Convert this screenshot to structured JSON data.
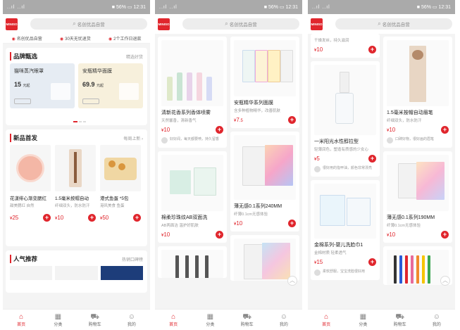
{
  "status": {
    "carrier": "..ıl ..ıl",
    "right": "■ 56% ▭ 12:31"
  },
  "logo": "MINISO",
  "search": {
    "placeholder": "名创优品自营"
  },
  "promises": [
    "名创优品自营",
    "30天无忧退货",
    "2个工作日退款"
  ],
  "screen1": {
    "brand": {
      "title": "品牌甄选",
      "more": "精选好货",
      "cards": [
        {
          "title": "猫咪蒸汽眼罩",
          "price": "15",
          "unit": "元起"
        },
        {
          "title": "安瓶精华面膜",
          "price": "69.9",
          "unit": "元起"
        }
      ]
    },
    "new": {
      "title": "新品首发",
      "more": "每周上新 ›",
      "items": [
        {
          "name": "花漾绯心渐变腮红",
          "sub": "甜美腮红 自然",
          "price": "25"
        },
        {
          "name": "1.5毫米按帽自动",
          "sub": "纤细双头，防水防汗",
          "price": "10"
        },
        {
          "name": "港式鱼蛋 *5包",
          "sub": "港风美食 鱼蛋",
          "price": "50"
        }
      ]
    },
    "popular": {
      "title": "人气推荐",
      "more": "热销口碑榜"
    }
  },
  "screen2": {
    "left": [
      {
        "name": "清新花香系列香体喷雾",
        "sub": "天然馨香，清新香气",
        "price": "10",
        "review": "好好闻，每天都要喷，持久留香"
      },
      {
        "name": "棉柔珍珠纹AB双面洗",
        "sub": "AB两面洁 温护好肌肤",
        "price": "10"
      }
    ],
    "right": [
      {
        "name": "安瓶精华系列面膜",
        "sub": "含多种植物精华，改善肌肤",
        "price": "7",
        "price_sup": ".5"
      },
      {
        "name": "薄无感0.1系列240MM",
        "sub": "纤薄0.1cm无感体验",
        "price": "10"
      }
    ]
  },
  "screen3": {
    "left": [
      {
        "name": "干燥发丝，持久滋润",
        "price": "10",
        "partial": true
      },
      {
        "name": "一米阳光水性醇拉型",
        "sub": "轻薄润色，塑造有质感的少女心",
        "price": "5",
        "review": "很好用的指甲油，颜色非常漂亮"
      },
      {
        "name": "金棉系列-婴儿洗脸巾1",
        "sub": "金棉材质 轻柔透气",
        "price": "15",
        "review": "柔软舒服，宝宝洗脸很好用"
      }
    ],
    "right": [
      {
        "name": "1.5毫米按帽自动眉笔",
        "sub": "纤细双头，防水防汗",
        "price": "10",
        "review": "口碑好物，很好画的眉笔"
      },
      {
        "name": "薄无感0.1系列190MM",
        "sub": "纤薄0.1cm无感体验",
        "price": "10"
      }
    ]
  },
  "tabs": [
    "首页",
    "分类",
    "购物车",
    "我的"
  ],
  "colors": {
    "accent": "#e0262d"
  }
}
